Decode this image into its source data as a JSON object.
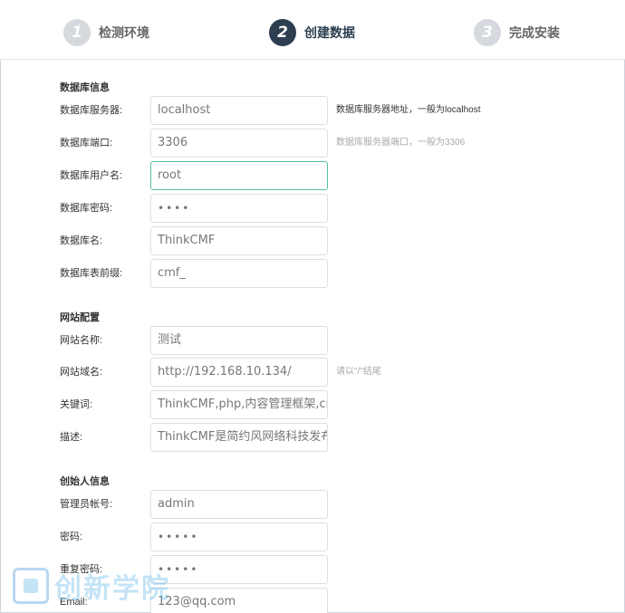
{
  "steps": [
    {
      "num": "1",
      "label": "检测环境"
    },
    {
      "num": "2",
      "label": "创建数据"
    },
    {
      "num": "3",
      "label": "完成安装"
    }
  ],
  "sections": {
    "db": "数据库信息",
    "site": "网站配置",
    "founder": "创始人信息"
  },
  "db": {
    "host_label": "数据库服务器:",
    "host_value": "localhost",
    "host_hint": "数据库服务器地址，一般为localhost",
    "port_label": "数据库端口:",
    "port_value": "3306",
    "port_hint": "数据库服务器端口，一般为3306",
    "user_label": "数据库用户名:",
    "user_value": "root",
    "pass_label": "数据库密码:",
    "pass_value": "••••",
    "name_label": "数据库名:",
    "name_value": "ThinkCMF",
    "prefix_label": "数据库表前缀:",
    "prefix_value": "cmf_"
  },
  "site": {
    "name_label": "网站名称:",
    "name_value": "测试",
    "domain_label": "网站域名:",
    "domain_value": "http://192.168.10.134/",
    "domain_hint": "请以\"/\"结尾",
    "keywords_label": "关键词:",
    "keywords_value": "ThinkCMF,php,内容管理框架,cmf",
    "desc_label": "描述:",
    "desc_value": "ThinkCMF是简约风网络科技发布"
  },
  "founder": {
    "account_label": "管理员帐号:",
    "account_value": "admin",
    "pass_label": "密码:",
    "pass_value": "•••••",
    "repass_label": "重复密码:",
    "repass_value": "•••••",
    "email_label": "Email:",
    "email_value": "123@qq.com"
  },
  "watermark": {
    "text": "创新学院"
  }
}
